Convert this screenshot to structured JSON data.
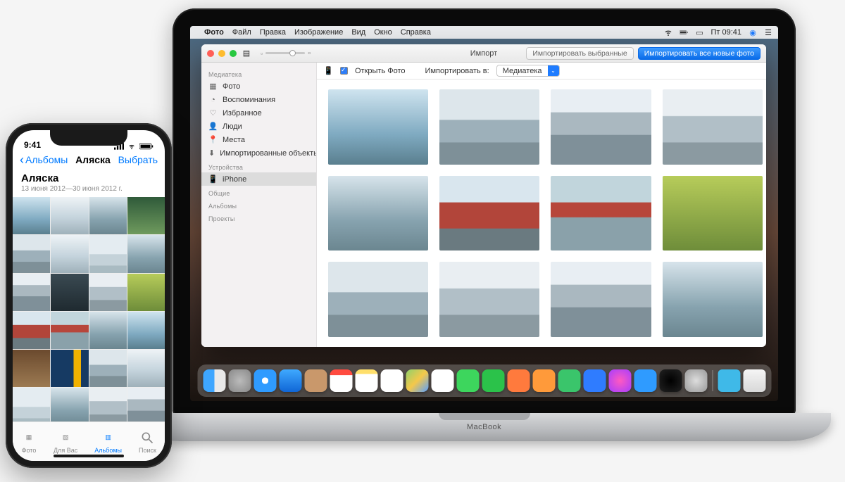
{
  "mac": {
    "menubar": {
      "app": "Фото",
      "items": [
        "Файл",
        "Правка",
        "Изображение",
        "Вид",
        "Окно",
        "Справка"
      ],
      "clock": "Пт 09:41"
    },
    "window": {
      "title": "Импорт",
      "btn_import_selected": "Импортировать выбранные",
      "btn_import_all": "Импортировать все новые фото",
      "open_photo_label": "Открыть Фото",
      "import_to_label": "Импортировать в:",
      "import_to_value": "Медиатека"
    },
    "sidebar": {
      "section_library": "Медиатека",
      "items_library": [
        "Фото",
        "Воспоминания",
        "Избранное",
        "Люди",
        "Места",
        "Импортированные объекты"
      ],
      "section_devices": "Устройства",
      "device": "iPhone",
      "section_shared": "Общие",
      "section_albums": "Альбомы",
      "section_projects": "Проекты"
    },
    "label": "MacBook"
  },
  "iphone": {
    "status_time": "9:41",
    "nav_back": "Альбомы",
    "nav_title": "Аляска",
    "nav_select": "Выбрать",
    "header_title": "Аляска",
    "header_sub": "13 июня 2012—30 июня 2012 г.",
    "tabs": {
      "photos": "Фото",
      "foryou": "Для Вас",
      "albums": "Альбомы",
      "search": "Поиск"
    }
  }
}
